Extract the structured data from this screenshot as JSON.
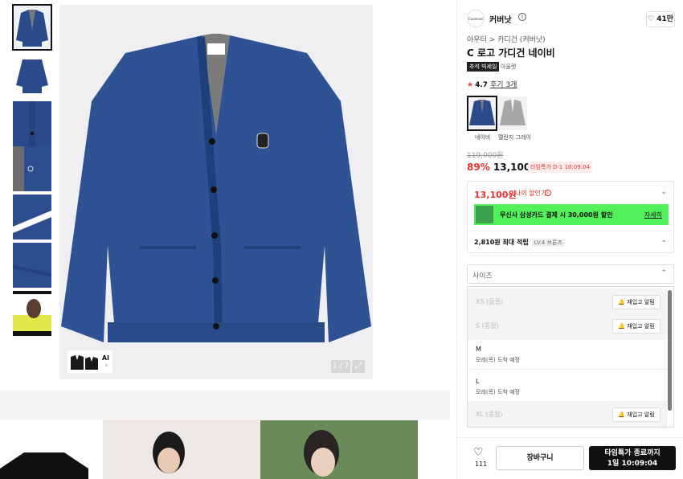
{
  "gallery": {
    "counter": "1 / 7",
    "ai_label": "AI",
    "thumbnails": [
      "thumbnail-front",
      "thumbnail-back",
      "thumbnail-detail-1",
      "thumbnail-detail-2",
      "thumbnail-detail-3",
      "thumbnail-detail-4",
      "thumbnail-model"
    ]
  },
  "brand": {
    "logo_text": "Covernat",
    "name": "커버낫",
    "likes": "41만"
  },
  "product": {
    "breadcrumb": "아우터 > 카디건 (커버낫)",
    "title": "C 로고 가디건 네이비",
    "badge_sale": "추석 빅세일",
    "badge_outlet": "아울렛",
    "rating": "4.7",
    "reviews": "후기 3개",
    "original_price": "119,000원",
    "discount_pct": "89%",
    "price": "13,100원",
    "timer_badge": "타임특가 D-1 10:09:04",
    "colors": [
      {
        "label": "네이비",
        "hex": "#2a4a8a"
      },
      {
        "label": "멜란지 그레이",
        "hex": "#a7a7a9"
      }
    ]
  },
  "benefits": {
    "my_price": "13,100원",
    "my_price_label": "나의 할인가",
    "card_text": "무신사 삼성카드 결제 시 30,000원 할인",
    "card_link": "자세히",
    "points": "2,810원 최대 적립",
    "level": "LV.4 브론즈"
  },
  "size": {
    "placeholder": "사이즈",
    "restock_label": "재입고 알림",
    "options": [
      {
        "name": "XS (품절)",
        "sub": "",
        "oos": true
      },
      {
        "name": "S (품절)",
        "sub": "",
        "oos": true
      },
      {
        "name": "M",
        "sub": "모레(목) 도착 예정",
        "oos": false
      },
      {
        "name": "L",
        "sub": "모레(목) 도착 예정",
        "oos": false
      },
      {
        "name": "XL (품절)",
        "sub": "",
        "oos": true
      }
    ]
  },
  "actions": {
    "like_count": "111",
    "cart_label": "장바구니",
    "buy_line1": "타임특가 종료까지",
    "buy_line2": "1일 10:09:04"
  },
  "colors": {
    "accent_red": "#e8322e",
    "card_green": "#52f05a",
    "navy": "#2a4a8a"
  }
}
